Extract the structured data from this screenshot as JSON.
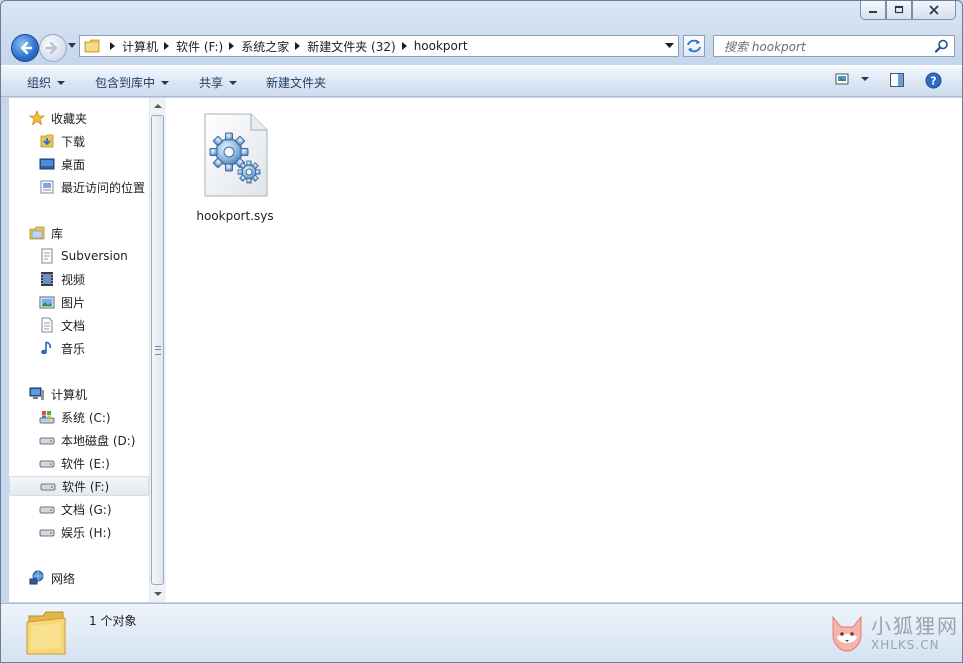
{
  "window": {
    "caption_buttons": [
      "minimize",
      "maximize",
      "close"
    ]
  },
  "address": {
    "crumbs": [
      "计算机",
      "软件 (F:)",
      "系统之家",
      "新建文件夹 (32)",
      "hookport"
    ]
  },
  "search": {
    "placeholder": "搜索 hookport"
  },
  "toolbar": {
    "organize": "组织",
    "include_library": "包含到库中",
    "share": "共享",
    "new_folder": "新建文件夹"
  },
  "nav": {
    "favorites": {
      "title": "收藏夹",
      "items": [
        "下载",
        "桌面",
        "最近访问的位置"
      ]
    },
    "libraries": {
      "title": "库",
      "items": [
        "Subversion",
        "视频",
        "图片",
        "文档",
        "音乐"
      ]
    },
    "computer": {
      "title": "计算机",
      "items": [
        "系统 (C:)",
        "本地磁盘 (D:)",
        "软件 (E:)",
        "软件 (F:)",
        "文档 (G:)",
        "娱乐 (H:)"
      ],
      "selected": "软件 (F:)"
    },
    "network": {
      "title": "网络"
    }
  },
  "files": [
    {
      "name": "hookport.sys",
      "icon": "system-file-gear-icon"
    }
  ],
  "status": {
    "count": "1 个对象"
  },
  "watermark": {
    "cn": "小狐狸网",
    "en": "XHLKS.CN"
  },
  "colors": {
    "frame": "#c6d6ec",
    "toolbar_text": "#1e3a5f",
    "selection": "#e6eaf0"
  }
}
